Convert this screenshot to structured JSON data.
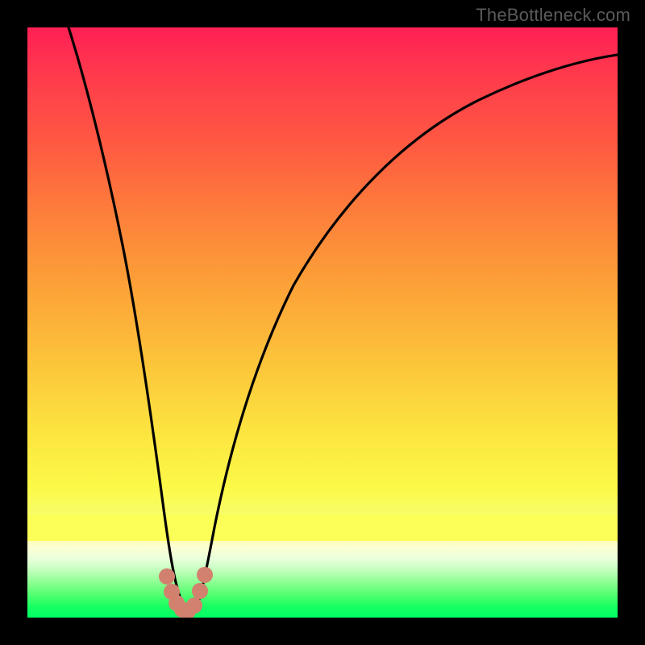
{
  "watermark": "TheBottleneck.com",
  "chart_data": {
    "type": "line",
    "title": "",
    "xlabel": "",
    "ylabel": "",
    "xlim": [
      0,
      100
    ],
    "ylim": [
      0,
      100
    ],
    "grid": false,
    "series": [
      {
        "name": "curve",
        "color": "#000000",
        "x": [
          7,
          9,
          12,
          15,
          17,
          19,
          20.5,
          22,
          23.5,
          25,
          26,
          27,
          28,
          29.5,
          31,
          33,
          36,
          40,
          45,
          52,
          60,
          70,
          80,
          90,
          100
        ],
        "y": [
          100,
          88,
          72,
          56,
          45,
          33,
          24,
          15,
          8,
          3,
          1,
          0,
          1,
          4,
          10,
          19,
          30,
          42,
          53,
          64,
          73,
          81,
          86,
          89,
          90
        ]
      }
    ],
    "markers": {
      "name": "valley-marker",
      "color": "#d2816f",
      "points": [
        {
          "x": 23.6,
          "y": 7
        },
        {
          "x": 24.4,
          "y": 4
        },
        {
          "x": 25.2,
          "y": 2
        },
        {
          "x": 26.2,
          "y": 1
        },
        {
          "x": 27.2,
          "y": 1
        },
        {
          "x": 28.3,
          "y": 2
        },
        {
          "x": 29.2,
          "y": 5
        },
        {
          "x": 30.0,
          "y": 8
        }
      ]
    },
    "background_gradient": {
      "top": "#ff1f55",
      "mid": "#fce33f",
      "bottom": "#00ff63"
    }
  }
}
